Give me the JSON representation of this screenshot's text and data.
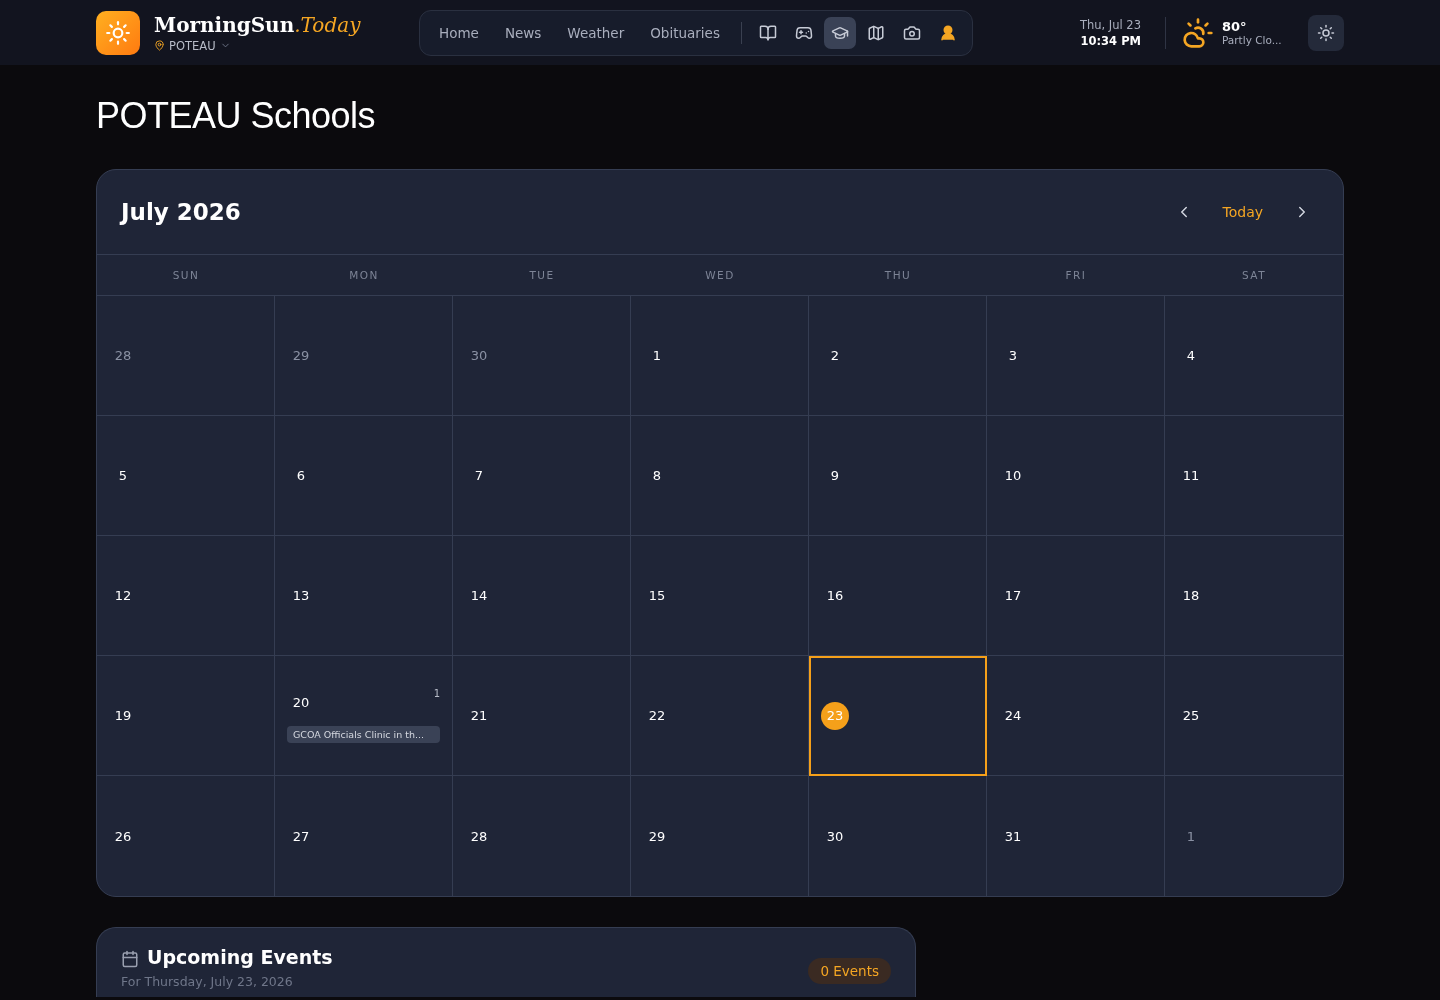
{
  "brand": {
    "name": "MorningSun",
    "suffix": ".Today",
    "location": "POTEAU"
  },
  "nav": {
    "links": [
      {
        "label": "Home",
        "selected": false
      },
      {
        "label": "News",
        "selected": false
      },
      {
        "label": "Weather",
        "selected": false
      },
      {
        "label": "Obituaries",
        "selected": false
      }
    ],
    "icon_buttons": [
      {
        "kind": "book",
        "selected": false
      },
      {
        "kind": "gamepad",
        "selected": false
      },
      {
        "kind": "school",
        "selected": true
      },
      {
        "kind": "map",
        "selected": false
      },
      {
        "kind": "camera",
        "selected": false
      },
      {
        "kind": "account",
        "selected": false
      }
    ]
  },
  "clock": {
    "date": "Thu, Jul 23",
    "time": "10:34 PM"
  },
  "weather": {
    "temperature": "80°",
    "condition": "Partly Clo..."
  },
  "page_title": "POTEAU Schools",
  "calendar": {
    "month": "July 2026",
    "today_button": "Today",
    "weekdays": [
      "SUN",
      "MON",
      "TUE",
      "WED",
      "THU",
      "FRI",
      "SAT"
    ],
    "weeks": [
      [
        {
          "day": "28",
          "outside": true,
          "selected": false
        },
        {
          "day": "29",
          "outside": true,
          "selected": false
        },
        {
          "day": "30",
          "outside": true,
          "selected": false
        },
        {
          "day": "1",
          "outside": false,
          "selected": false
        },
        {
          "day": "2",
          "outside": false,
          "selected": false
        },
        {
          "day": "3",
          "outside": false,
          "selected": false
        },
        {
          "day": "4",
          "outside": false,
          "selected": false
        }
      ],
      [
        {
          "day": "5",
          "outside": false,
          "selected": false
        },
        {
          "day": "6",
          "outside": false,
          "selected": false
        },
        {
          "day": "7",
          "outside": false,
          "selected": false
        },
        {
          "day": "8",
          "outside": false,
          "selected": false
        },
        {
          "day": "9",
          "outside": false,
          "selected": false
        },
        {
          "day": "10",
          "outside": false,
          "selected": false
        },
        {
          "day": "11",
          "outside": false,
          "selected": false
        }
      ],
      [
        {
          "day": "12",
          "outside": false,
          "selected": false
        },
        {
          "day": "13",
          "outside": false,
          "selected": false
        },
        {
          "day": "14",
          "outside": false,
          "selected": false
        },
        {
          "day": "15",
          "outside": false,
          "selected": false
        },
        {
          "day": "16",
          "outside": false,
          "selected": false
        },
        {
          "day": "17",
          "outside": false,
          "selected": false
        },
        {
          "day": "18",
          "outside": false,
          "selected": false
        }
      ],
      [
        {
          "day": "19",
          "outside": false,
          "selected": false
        },
        {
          "day": "20",
          "outside": false,
          "selected": false,
          "count": "1",
          "events": [
            "GCOA Officials Clinic in th..."
          ]
        },
        {
          "day": "21",
          "outside": false,
          "selected": false
        },
        {
          "day": "22",
          "outside": false,
          "selected": false
        },
        {
          "day": "23",
          "outside": false,
          "selected": true
        },
        {
          "day": "24",
          "outside": false,
          "selected": false
        },
        {
          "day": "25",
          "outside": false,
          "selected": false
        }
      ],
      [
        {
          "day": "26",
          "outside": false,
          "selected": false
        },
        {
          "day": "27",
          "outside": false,
          "selected": false
        },
        {
          "day": "28",
          "outside": false,
          "selected": false
        },
        {
          "day": "29",
          "outside": false,
          "selected": false
        },
        {
          "day": "30",
          "outside": false,
          "selected": false
        },
        {
          "day": "31",
          "outside": false,
          "selected": false
        },
        {
          "day": "1",
          "outside": true,
          "selected": false
        }
      ]
    ]
  },
  "upcoming": {
    "title": "Upcoming Events",
    "subtitle": "For Thursday, July 23, 2026",
    "badge": "0 Events"
  }
}
